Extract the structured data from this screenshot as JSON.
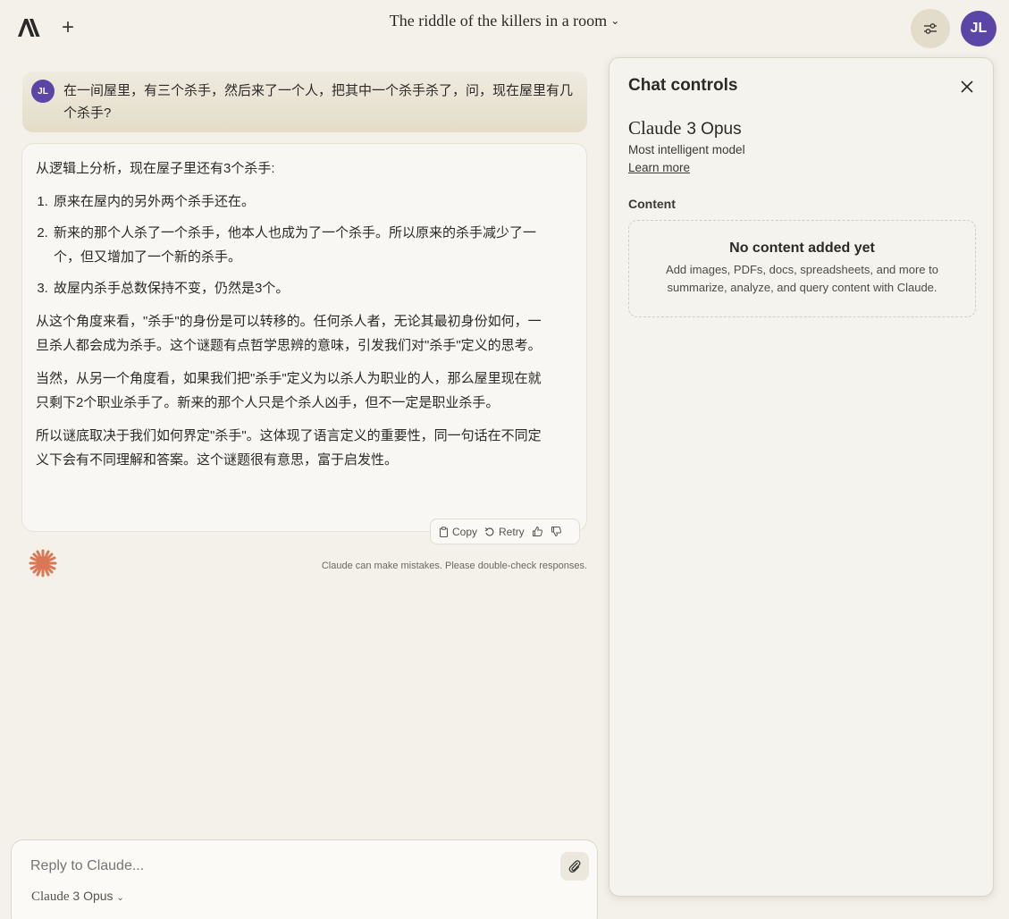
{
  "header": {
    "title": "The riddle of the killers in a room",
    "new_chat": "+",
    "avatar_initials": "JL"
  },
  "user_message": {
    "avatar_initials": "JL",
    "text": "在一间屋里，有三个杀手，然后来了一个人，把其中一个杀手杀了，问，现在屋里有几个杀手?"
  },
  "assistant_message": {
    "intro": "从逻辑上分析，现在屋子里还有3个杀手:",
    "list": [
      "原来在屋内的另外两个杀手还在。",
      "新来的那个人杀了一个杀手，他本人也成为了一个杀手。所以原来的杀手减少了一个，但又增加了一个新的杀手。",
      "故屋内杀手总数保持不变，仍然是3个。"
    ],
    "paragraphs": [
      "从这个角度来看，\"杀手\"的身份是可以转移的。任何杀人者，无论其最初身份如何，一旦杀人都会成为杀手。这个谜题有点哲学思辨的意味，引发我们对\"杀手\"定义的思考。",
      "当然，从另一个角度看，如果我们把\"杀手\"定义为以杀人为职业的人，那么屋里现在就只剩下2个职业杀手了。新来的那个人只是个杀人凶手，但不一定是职业杀手。",
      "所以谜底取决于我们如何界定\"杀手\"。这体现了语言定义的重要性，同一句话在不同定义下会有不同理解和答案。这个谜题很有意思，富于启发性。"
    ]
  },
  "message_actions": {
    "copy": "Copy",
    "retry": "Retry"
  },
  "disclaimer": "Claude can make mistakes. Please double-check responses.",
  "composer": {
    "placeholder": "Reply to Claude...",
    "model_brand": "Claude",
    "model_version": "3 Opus"
  },
  "panel": {
    "title": "Chat controls",
    "model_brand": "Claude",
    "model_version": "3 Opus",
    "model_description": "Most intelligent model",
    "learn_more": "Learn more",
    "content_label": "Content",
    "empty_title": "No content added yet",
    "empty_description": "Add images, PDFs, docs, spreadsheets, and more to summarize, analyze, and query content with Claude."
  },
  "colors": {
    "background": "#f3f1ea",
    "avatar": "#5b45a6",
    "accent_spark": "#d97757",
    "controls_button": "#e3dccb"
  },
  "icons": {
    "logo": "anthropic-logo",
    "new_chat": "plus-icon",
    "controls": "sliders-icon",
    "close": "close-icon",
    "copy": "clipboard-icon",
    "retry": "retry-icon",
    "thumbs_up": "thumbs-up-icon",
    "thumbs_down": "thumbs-down-icon",
    "attach": "paperclip-icon",
    "spark": "claude-spark-icon"
  }
}
